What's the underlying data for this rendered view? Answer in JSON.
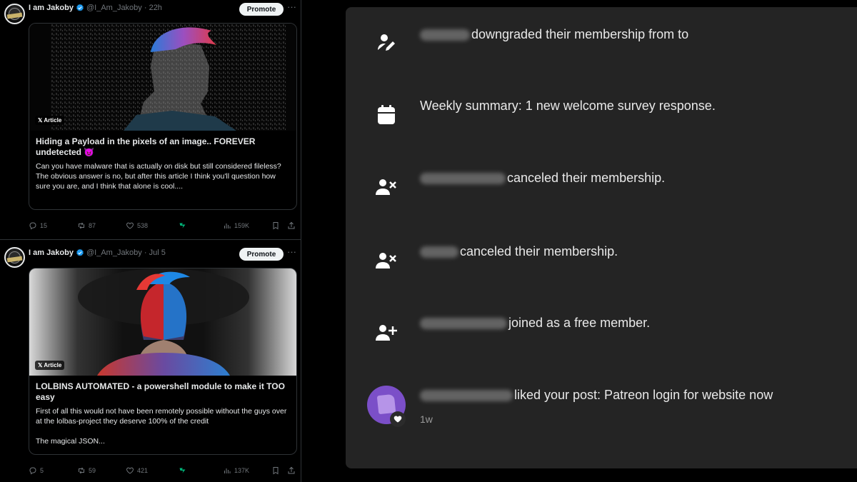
{
  "feed": {
    "tweets": [
      {
        "name": "I am Jakoby",
        "handle_time": "@I_Am_Jakoby · 22h",
        "promote_label": "Promote",
        "more_label": "···",
        "badge_label": "𝕏 Article",
        "title": "Hiding a Payload in the  pixels of an image.. FOREVER undetected 😈",
        "body_lines": [
          "Can you have malware that is actually on disk but still considered fileless?",
          "The obvious answer is no, but after this article I think you'll question how sure you are, and I think that alone is cool...."
        ],
        "stats": {
          "replies": "15",
          "reposts": "87",
          "likes": "538",
          "views": "159K"
        }
      },
      {
        "name": "I am Jakoby",
        "handle_time": "@I_Am_Jakoby · Jul 5",
        "promote_label": "Promote",
        "more_label": "···",
        "badge_label": "𝕏 Article",
        "title": "LOLBINS AUTOMATED - a powershell module to make it TOO easy",
        "body_lines": [
          "First of all this would not have been remotely possible without the guys over at the lolbas-project they deserve 100% of the credit",
          "The magical JSON..."
        ],
        "stats": {
          "replies": "5",
          "reposts": "59",
          "likes": "421",
          "views": "137K"
        }
      }
    ]
  },
  "notifications": {
    "items": [
      {
        "icon": "user-edit-icon",
        "text": "downgraded their membership from to"
      },
      {
        "icon": "calendar-icon",
        "text": "Weekly summary: 1 new welcome survey response."
      },
      {
        "icon": "user-remove-icon",
        "text": "canceled their membership."
      },
      {
        "icon": "user-remove-icon",
        "text": "canceled their membership."
      },
      {
        "icon": "user-add-icon",
        "text": "joined as a free member."
      },
      {
        "icon": "heart-icon",
        "text": "liked your post: Patreon login for website now",
        "time": "1w"
      }
    ]
  },
  "colors": {
    "accent_blue": "#1d9bf0",
    "panel_bg": "#242424",
    "avatar_purple": "#7b4fc8",
    "feed_bg": "#000000"
  }
}
